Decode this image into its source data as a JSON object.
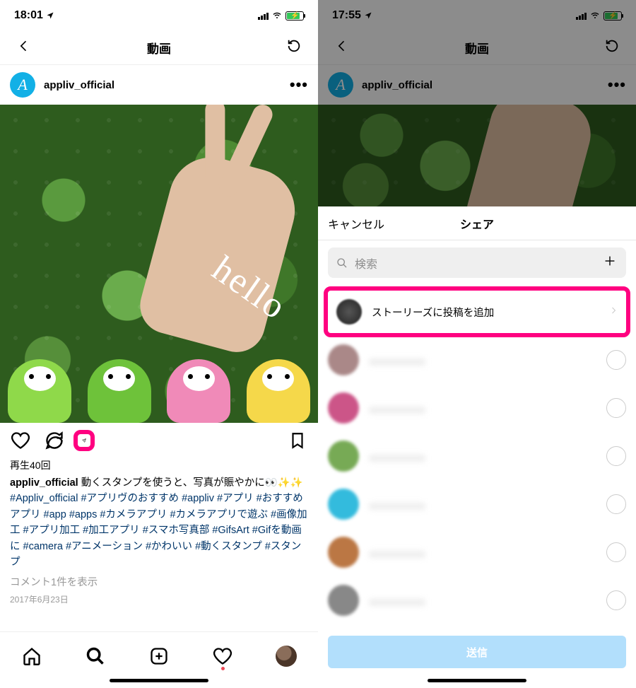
{
  "left": {
    "status": {
      "time": "18:01"
    },
    "nav": {
      "title": "動画"
    },
    "author": {
      "username": "appliv_official",
      "avatar_letter": "A"
    },
    "media": {
      "overlay_text": "hello"
    },
    "plays": "再生40回",
    "caption": {
      "username": "appliv_official",
      "text": " 動くスタンプを使うと、写真が賑やかに👀✨✨",
      "hashtags": "#Appliv_official #アプリヴのおすすめ #appliv #アプリ #おすすめアプリ #app #apps #カメラアプリ #カメラアプリで遊ぶ #画像加工 #アプリ加工 #加工アプリ #スマホ写真部 #GifsArt #Gifを動画に #camera #アニメーション #かわいい #動くスタンプ #スタンプ"
    },
    "comments_link": "コメント1件を表示",
    "date": "2017年6月23日"
  },
  "right": {
    "status": {
      "time": "17:55"
    },
    "nav": {
      "title": "動画"
    },
    "author": {
      "username": "appliv_official",
      "avatar_letter": "A"
    },
    "sheet": {
      "cancel": "キャンセル",
      "title": "シェア",
      "search_placeholder": "検索",
      "story_row": "ストーリーズに投稿を追加",
      "send": "送信"
    }
  },
  "colors": {
    "highlight": "#ff0080",
    "link": "#003569",
    "brand": "#12b0e6"
  }
}
